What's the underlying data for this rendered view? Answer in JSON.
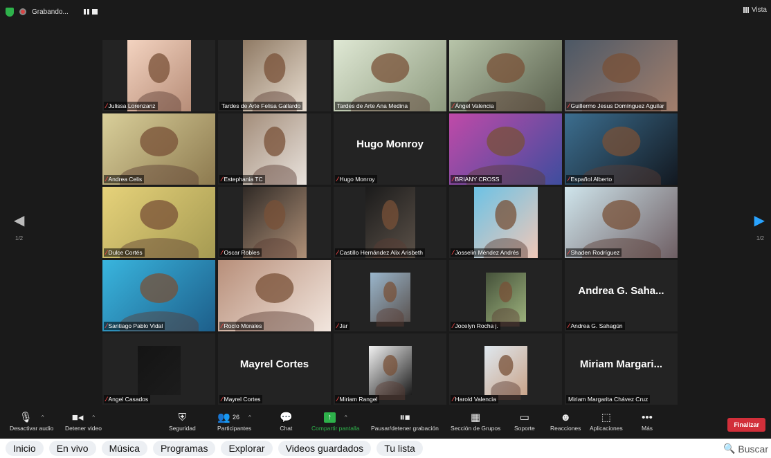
{
  "meeting": {
    "recording_label": "Grabando...",
    "view_label": "Vista",
    "page_indicator_left": "1/2",
    "page_indicator_right": "1/2"
  },
  "participants": [
    {
      "name": "Julissa Lorenzanz",
      "mic_muted": true,
      "video": true
    },
    {
      "name": "Tardes de Arte Felisa Gallardo",
      "mic_muted": false,
      "video": true
    },
    {
      "name": "Tardes de Arte Ana Medina",
      "mic_muted": false,
      "video": true,
      "active_speaker": true
    },
    {
      "name": "Ángel Valencia",
      "mic_muted": true,
      "video": true
    },
    {
      "name": "Guillermo Jesus Domínguez Aguilar",
      "mic_muted": true,
      "video": true
    },
    {
      "name": "Andrea Celis",
      "mic_muted": true,
      "video": true
    },
    {
      "name": "Estephania TC",
      "mic_muted": true,
      "video": true
    },
    {
      "name": "Hugo Monroy",
      "mic_muted": true,
      "video": false,
      "display_name": "Hugo Monroy"
    },
    {
      "name": "BRIANY CROSS",
      "mic_muted": true,
      "video": true
    },
    {
      "name": "Español Alberto",
      "mic_muted": true,
      "video": true
    },
    {
      "name": "Dulce Cortés",
      "mic_muted": true,
      "video": true
    },
    {
      "name": "Oscar Robles",
      "mic_muted": true,
      "video": true
    },
    {
      "name": "Castillo Hernández Alix Arisbeth",
      "mic_muted": true,
      "video": true
    },
    {
      "name": "Josselin Méndez Andrés",
      "mic_muted": true,
      "video": true
    },
    {
      "name": "Shaden Rodríguez",
      "mic_muted": true,
      "video": true
    },
    {
      "name": "Santiago Pablo Vidal",
      "mic_muted": true,
      "video": true
    },
    {
      "name": "Rocío Morales",
      "mic_muted": true,
      "video": true
    },
    {
      "name": "Jar",
      "mic_muted": true,
      "video": true,
      "avatar": true
    },
    {
      "name": "Jocelyn Rocha j.",
      "mic_muted": true,
      "video": true,
      "avatar": true
    },
    {
      "name": "Andrea G. Sahagún",
      "mic_muted": true,
      "video": false,
      "display_name": "Andrea G. Saha..."
    },
    {
      "name": "Angel Casados",
      "mic_muted": true,
      "video": true,
      "avatar": true
    },
    {
      "name": "Mayrel Cortes",
      "mic_muted": true,
      "video": false,
      "display_name": "Mayrel Cortes"
    },
    {
      "name": "Miriam Rangel",
      "mic_muted": true,
      "video": true,
      "avatar": true
    },
    {
      "name": "Harold Valencia",
      "mic_muted": true,
      "video": true,
      "avatar": true
    },
    {
      "name": "Miriam Margarita Chávez Cruz",
      "mic_muted": false,
      "video": false,
      "display_name": "Miriam Margari..."
    }
  ],
  "toolbar": {
    "mute_label": "Desactivar audio",
    "video_label": "Detener video",
    "security_label": "Seguridad",
    "participants_label": "Participantes",
    "participants_count": "26",
    "chat_label": "Chat",
    "share_label": "Compartir pantalla",
    "record_label": "Pausar/detener grabación",
    "breakout_label": "Sección de Grupos",
    "support_label": "Soporte",
    "reactions_label": "Reacciones",
    "apps_label": "Aplicaciones",
    "more_label": "Más",
    "end_label": "Finalizar"
  },
  "browser_nav": {
    "items": [
      "Inicio",
      "En vivo",
      "Música",
      "Programas",
      "Explorar",
      "Videos guardados",
      "Tu lista"
    ],
    "search_label": "Buscar"
  },
  "colors": {
    "tile_bg": "#232323",
    "active_outline": "#d7d44a",
    "end_button": "#d22f3a",
    "share_green": "#2eb24b",
    "muted_red": "#ff4a4a",
    "next_arrow": "#29a3ff"
  }
}
